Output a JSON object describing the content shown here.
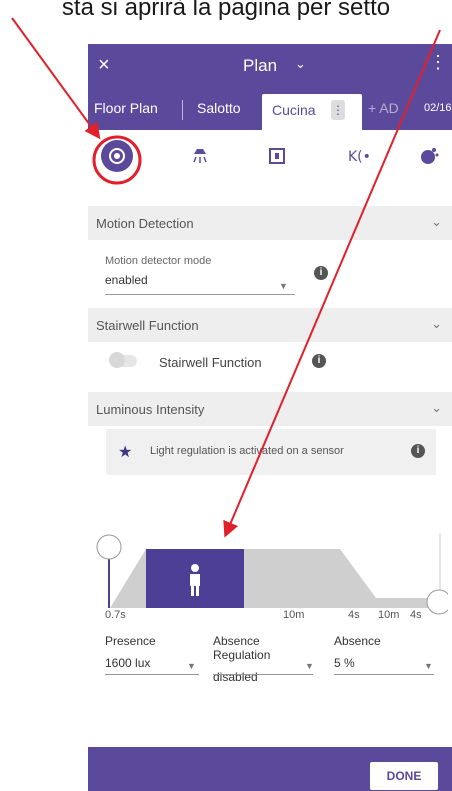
{
  "caption": "sta si aprirà la pagina per setto",
  "header": {
    "close_icon": "×",
    "title": "Plan",
    "chevron": "⌄",
    "more": "⋮"
  },
  "tabs": {
    "floor_plan": "Floor Plan",
    "salotto": "Salotto",
    "cucina": "Cucina",
    "menu_dots": "⋮",
    "add": "+ AD",
    "counter": "02/16"
  },
  "sections": {
    "motion": {
      "title": "Motion Detection",
      "mode_label": "Motion detector mode",
      "mode_value": "enabled"
    },
    "stairwell": {
      "title": "Stairwell Function",
      "toggle_label": "Stairwell Function"
    },
    "luminous": {
      "title": "Luminous Intensity",
      "message": "Light regulation is activated on a sensor"
    }
  },
  "chart_labels": {
    "t1": "0.7s",
    "t2": "10m",
    "t3": "4s",
    "t4": "10m",
    "t5": "4s"
  },
  "controls": {
    "presence": {
      "label": "Presence",
      "value": "1600 lux"
    },
    "absence_reg": {
      "label": "Absence Regulation",
      "value": "disabled"
    },
    "absence": {
      "label": "Absence",
      "value": "5 %"
    }
  },
  "footer": {
    "done": "DONE"
  },
  "colors": {
    "primary": "#5b4a9b",
    "accent_red": "#e0202a",
    "chart_grey": "#cfcfcf"
  },
  "icons": [
    "motion-sensor-icon",
    "ceiling-light-icon",
    "switch-icon",
    "signal-icon",
    "scene-icon"
  ]
}
